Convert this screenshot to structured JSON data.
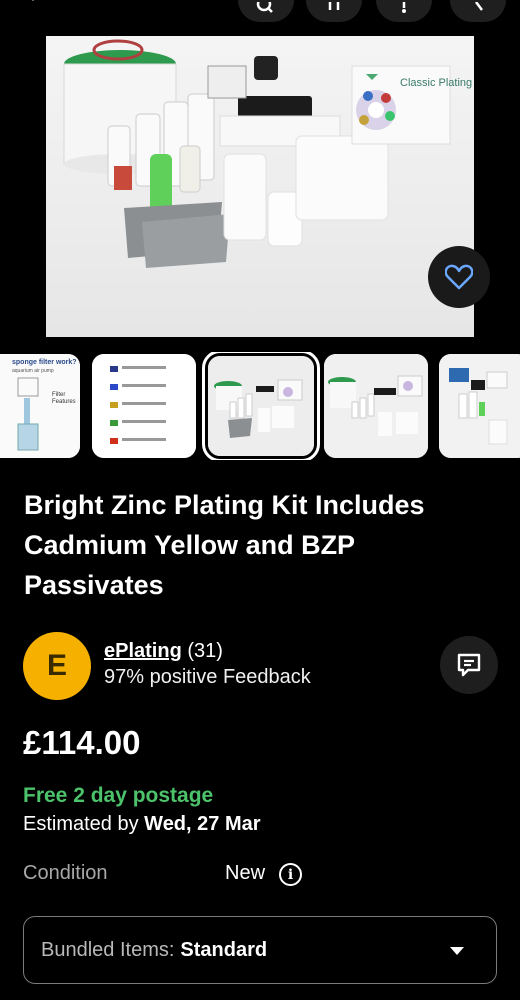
{
  "listing": {
    "title": "Bright Zinc Plating Kit Includes Cadmium Yellow and BZP Passivates",
    "hero_label": "Classic Plating",
    "price": "£114.00",
    "postage": "Free 2 day postage",
    "estimate_prefix": "Estimated by ",
    "estimate_date": "Wed, 27 Mar"
  },
  "seller": {
    "initial": "E",
    "name": "ePlating",
    "count": " (31)",
    "feedback": "97% positive Feedback"
  },
  "condition": {
    "label": "Condition",
    "value": "New"
  },
  "bundled": {
    "label": "Bundled Items:",
    "value": "Standard"
  },
  "thumbs": {
    "thumb1_title": "sponge filter work?",
    "thumb1_sub": "aquarium air pump",
    "thumb1_labels": [
      "Filter",
      "Features"
    ]
  },
  "colors": {
    "background": "#000000",
    "accent_green": "#4cc26b",
    "avatar": "#f6b100",
    "favorite_icon": "#6aa8ff"
  }
}
